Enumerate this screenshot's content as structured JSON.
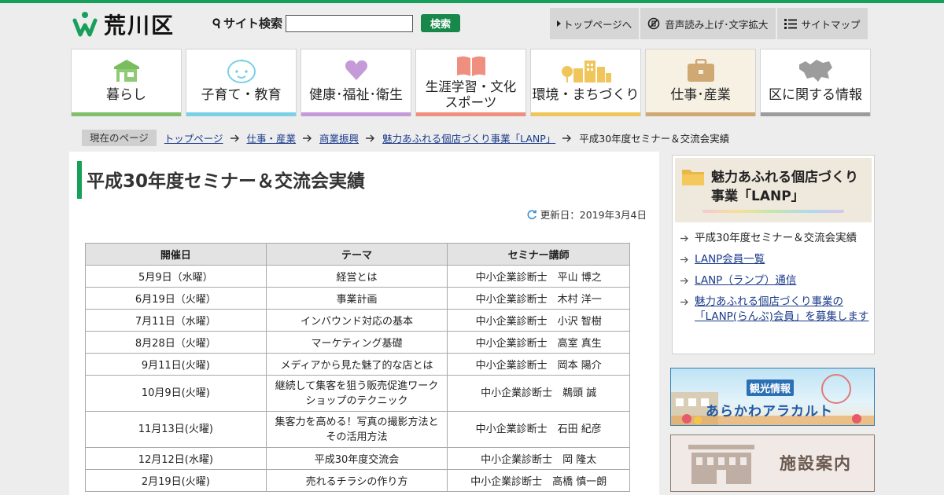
{
  "site": {
    "name": "荒川区"
  },
  "search": {
    "label": "サイト検索",
    "value": "",
    "button": "検索"
  },
  "utility": [
    {
      "label": "トップページへ"
    },
    {
      "label": "音声読み上げ･文字拡大"
    },
    {
      "label": "サイトマップ"
    }
  ],
  "categories": [
    {
      "label": "暮らし",
      "color": "#7fbf6a"
    },
    {
      "label": "子育て・教育",
      "color": "#7ad0e4"
    },
    {
      "label": "健康･福祉･衛生",
      "color": "#c49ad8"
    },
    {
      "label": "生涯学習・文化\nスポーツ",
      "color": "#ef8f80"
    },
    {
      "label": "環境・まちづくり",
      "color": "#f0c55c"
    },
    {
      "label": "仕事･産業",
      "color": "#cfa873"
    },
    {
      "label": "区に関する情報",
      "color": "#9c9c9c"
    }
  ],
  "breadcrumb": {
    "here": "現在のページ",
    "links": [
      "トップページ",
      "仕事・産業",
      "商業振興",
      "魅力あふれる個店づくり事業「LANP」"
    ],
    "current": "平成30年度セミナー＆交流会実績"
  },
  "page": {
    "title": "平成30年度セミナー＆交流会実績",
    "updated": "更新日：2019年3月4日"
  },
  "table": {
    "headers": [
      "開催日",
      "テーマ",
      "セミナー講師"
    ],
    "rows": [
      [
        "5月9日（水曜）",
        "経営とは",
        "中小企業診断士　平山 博之"
      ],
      [
        "6月19日（火曜）",
        "事業計画",
        "中小企業診断士　木村 洋一"
      ],
      [
        "7月11日（水曜）",
        "インバウンド対応の基本",
        "中小企業診断士　小沢 智樹"
      ],
      [
        "8月28日（火曜）",
        "マーケティング基礎",
        "中小企業診断士　高室 真生"
      ],
      [
        "9月11日(火曜)",
        "メディアから見た魅了的な店とは",
        "中小企業診断士　岡本 陽介"
      ],
      [
        "10月9日(火曜)",
        "継続して集客を狙う販売促進ワークショップのテクニック",
        "中小企業診断士　鵜頭 誠"
      ],
      [
        "11月13日(火曜)",
        "集客力を高める！写真の撮影方法とその活用方法",
        "中小企業診断士　石田 紀彦"
      ],
      [
        "12月12日(水曜)",
        "平成30年度交流会",
        "中小企業診断士　岡 隆太"
      ],
      [
        "2月19日(火曜)",
        "売れるチラシの作り方",
        "中小企業診断士　高橋 慎一朗"
      ]
    ]
  },
  "sidebar": {
    "title": "魅力あふれる個店づくり事業「LANP」",
    "items": [
      {
        "label": "平成30年度セミナー＆交流会実績"
      },
      {
        "label": "LANP会員一覧"
      },
      {
        "label": "LANP（ランプ）通信"
      },
      {
        "label": "魅力あふれる個店づくり事業の「LANP(らんぷ)会員」を募集します"
      }
    ]
  },
  "banners": {
    "tourism_sub": "観光情報",
    "tourism_main": "あらかわアラカルト",
    "facilities": "施設案内"
  }
}
